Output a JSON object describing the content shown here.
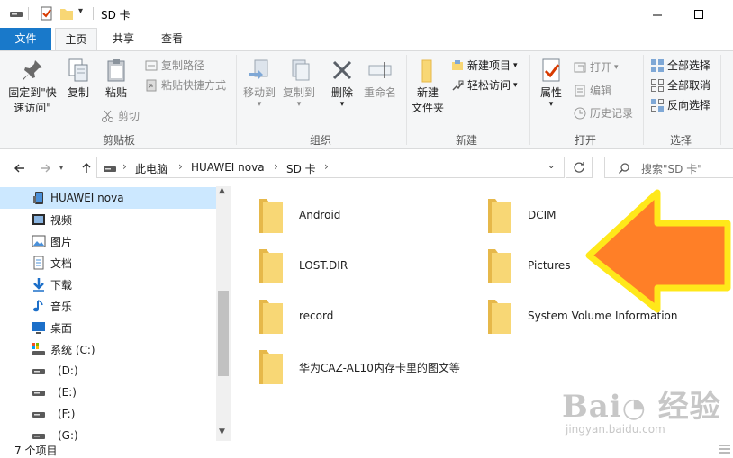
{
  "window": {
    "title": "SD 卡"
  },
  "tabs": [
    {
      "label": "文件"
    },
    {
      "label": "主页"
    },
    {
      "label": "共享"
    },
    {
      "label": "查看"
    }
  ],
  "ribbon": {
    "clipboard": {
      "group_label": "剪贴板",
      "pin_label_1": "固定到\"快",
      "pin_label_2": "速访问\"",
      "copy_label": "复制",
      "paste_label": "粘贴",
      "copy_path_label": "复制路径",
      "paste_shortcut_label": "粘贴快捷方式",
      "cut_label": "剪切"
    },
    "organize": {
      "group_label": "组织",
      "move_to_label": "移动到",
      "copy_to_label": "复制到",
      "delete_label": "删除",
      "rename_label": "重命名"
    },
    "new": {
      "group_label": "新建",
      "new_folder_label_1": "新建",
      "new_folder_label_2": "文件夹",
      "new_item_label": "新建项目",
      "easy_access_label": "轻松访问"
    },
    "open": {
      "group_label": "打开",
      "properties_label": "属性",
      "open_label": "打开",
      "edit_label": "编辑",
      "history_label": "历史记录"
    },
    "select": {
      "group_label": "选择",
      "select_all_label": "全部选择",
      "select_none_label": "全部取消",
      "invert_label": "反向选择"
    }
  },
  "address": {
    "crumbs": [
      "此电脑",
      "HUAWEI nova",
      "SD 卡"
    ],
    "search_placeholder": "搜索\"SD 卡\""
  },
  "navpane": {
    "items": [
      {
        "label": "HUAWEI nova",
        "icon": "phone-icon"
      },
      {
        "label": "视频",
        "icon": "video-icon"
      },
      {
        "label": "图片",
        "icon": "pictures-icon"
      },
      {
        "label": "文档",
        "icon": "document-icon"
      },
      {
        "label": "下载",
        "icon": "download-icon"
      },
      {
        "label": "音乐",
        "icon": "music-icon"
      },
      {
        "label": "桌面",
        "icon": "desktop-icon"
      },
      {
        "label": "系统 (C:)",
        "icon": "system-drive-icon"
      },
      {
        "label": "(D:)",
        "icon": "drive-icon"
      },
      {
        "label": "(E:)",
        "icon": "drive-icon"
      },
      {
        "label": "(F:)",
        "icon": "drive-icon"
      },
      {
        "label": "(G:)",
        "icon": "drive-icon"
      }
    ]
  },
  "folders": [
    {
      "name": "Android"
    },
    {
      "name": "DCIM"
    },
    {
      "name": "LOST.DIR"
    },
    {
      "name": "Pictures"
    },
    {
      "name": "record"
    },
    {
      "name": "System Volume Information"
    },
    {
      "name": "华为CAZ-AL10内存卡里的图文等"
    }
  ],
  "status": {
    "item_count": "7 个项目"
  },
  "colors": {
    "accent": "#1979ca",
    "folder": "#f8d775",
    "folder_dark": "#e6b84a",
    "selection": "#cce8ff",
    "arrow_fill": "#ff7f27",
    "arrow_border": "#ffe81a"
  }
}
